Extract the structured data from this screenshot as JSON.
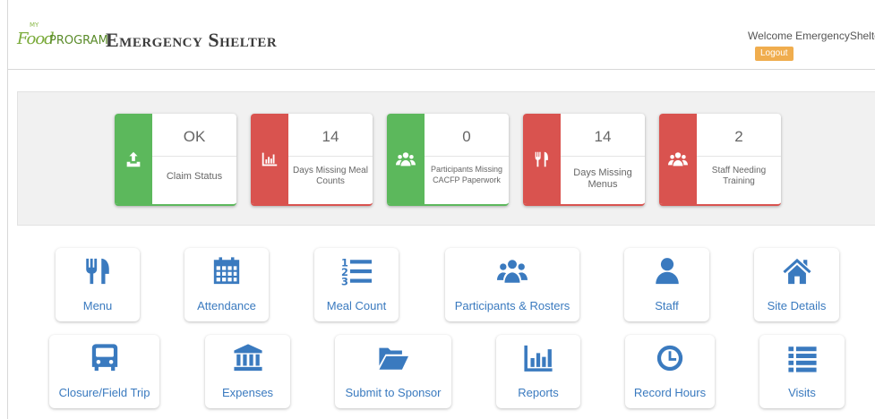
{
  "header": {
    "logo_my": "MY",
    "logo_food": "Food",
    "logo_program": "PROGRAM",
    "title": "Emergency Shelter",
    "welcome": "Welcome EmergencyShelte",
    "logout_label": "Logout"
  },
  "stats": [
    {
      "value": "OK",
      "label": "Claim Status",
      "color": "#5cb85c",
      "icon": "upload-icon"
    },
    {
      "value": "14",
      "label": "Days Missing Meal Counts",
      "color": "#d9534f",
      "icon": "bar-chart-icon"
    },
    {
      "value": "0",
      "label": "Participants Missing CACFP Paperwork",
      "color": "#5cb85c",
      "icon": "users-icon"
    },
    {
      "value": "14",
      "label": "Days Missing Menus",
      "color": "#d9534f",
      "icon": "utensils-icon"
    },
    {
      "value": "2",
      "label": "Staff Needing Training",
      "color": "#d9534f",
      "icon": "users-icon"
    }
  ],
  "tiles_row1": [
    {
      "label": "Menu",
      "icon": "utensils-icon"
    },
    {
      "label": "Attendance",
      "icon": "calendar-icon"
    },
    {
      "label": "Meal Count",
      "icon": "numbered-list-icon"
    },
    {
      "label": "Participants & Rosters",
      "icon": "users-icon"
    },
    {
      "label": "Staff",
      "icon": "user-icon"
    },
    {
      "label": "Site Details",
      "icon": "home-icon"
    }
  ],
  "tiles_row2": [
    {
      "label": "Closure/Field Trip",
      "icon": "bus-icon"
    },
    {
      "label": "Expenses",
      "icon": "bank-icon"
    },
    {
      "label": "Submit to Sponsor",
      "icon": "folder-open-icon"
    },
    {
      "label": "Reports",
      "icon": "bar-chart-icon"
    },
    {
      "label": "Record Hours",
      "icon": "clock-icon"
    },
    {
      "label": "Visits",
      "icon": "list-icon"
    }
  ],
  "colors": {
    "accent_blue": "#3a7abf",
    "green": "#5cb85c",
    "red": "#d9534f",
    "logout_orange": "#f0ad4e"
  }
}
